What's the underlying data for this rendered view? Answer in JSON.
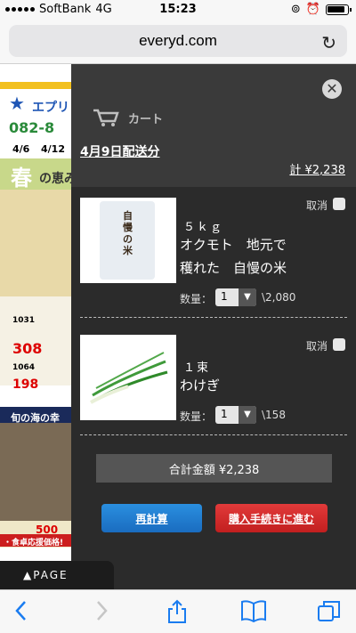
{
  "status": {
    "carrier": "SoftBank",
    "network": "4G",
    "time": "15:23"
  },
  "browser": {
    "url": "everyd.com"
  },
  "flyer": {
    "company": "エプリ",
    "phone": "082-8",
    "dates": "4/6",
    "dates2": "4/12",
    "spring": "春",
    "spring2": "の恵み",
    "sea": "旬の海の幸",
    "price1": "308",
    "price2": "198",
    "price3": "500",
    "code1": "1031",
    "code2": "1064",
    "banner": "・食卓応援価格!"
  },
  "cart": {
    "title": "カート",
    "delivery": "4月9日配送分",
    "total_top": "計 ¥2,238",
    "cancel_label": "取消",
    "qty_label": "数量：",
    "items": [
      {
        "unit": "５ｋｇ",
        "name_line1": "オクモト　地元で",
        "name_line2": "穫れた　自慢の米",
        "qty": "1",
        "price": "\\2,080",
        "photo_text": "自慢の米"
      },
      {
        "unit": "１束",
        "name_line1": "わけぎ",
        "name_line2": "",
        "qty": "1",
        "price": "\\158",
        "photo_text": ""
      }
    ],
    "sum_label": "合計金額 ¥2,238",
    "recalc": "再計算",
    "checkout": "購入手続きに進む"
  },
  "page_button": "▲PAGE",
  "colors": {
    "panel": "#2b2b2b",
    "recalc": "#1a6cc0",
    "checkout": "#c21f1f"
  }
}
